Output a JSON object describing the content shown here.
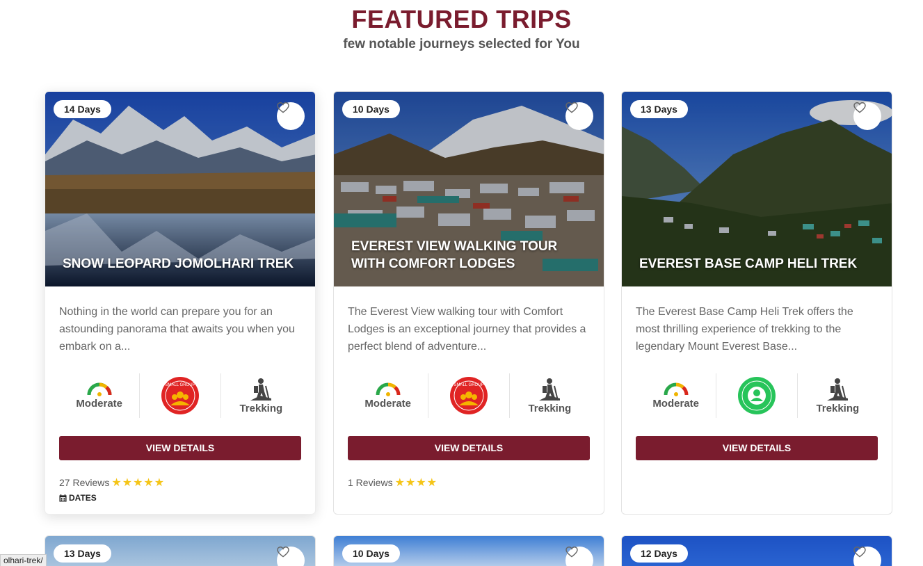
{
  "header": {
    "title": "FEATURED TRIPS",
    "subtitle": "few notable journeys selected for You"
  },
  "cards": [
    {
      "days": "14 Days",
      "title": "SNOW LEOPARD JOMOLHARI TREK",
      "description": "Nothing in the world can prepare you for an astounding panorama that awaits you when you embark on a...",
      "difficulty": "Moderate",
      "group_badge": "SMALL GROUP JOURNEYS",
      "group_badge_color": "#e02424",
      "activity": "Trekking",
      "button": "VIEW DETAILS",
      "reviews": "27 Reviews",
      "rating": 5,
      "dates": "DATES"
    },
    {
      "days": "10 Days",
      "title": "EVEREST VIEW WALKING TOUR WITH COMFORT LODGES",
      "description": "The Everest View walking tour with Comfort Lodges is an exceptional journey that provides a perfect blend of adventure...",
      "difficulty": "Moderate",
      "group_badge": "SMALL GROUP JOURNEYS",
      "group_badge_color": "#e02424",
      "activity": "Trekking",
      "button": "VIEW DETAILS",
      "reviews": "1 Reviews",
      "rating": 4
    },
    {
      "days": "13 Days",
      "title": "EVEREST BASE CAMP HELI TREK",
      "description": "The Everest Base Camp Heli Trek offers the most thrilling experience of trekking to the legendary Mount Everest Base...",
      "difficulty": "Moderate",
      "group_badge": "INDEPENDENT PRIVATE JOURNEYS",
      "group_badge_color": "#27c45a",
      "activity": "Trekking",
      "button": "VIEW DETAILS"
    }
  ],
  "next_row": [
    {
      "days": "13 Days"
    },
    {
      "days": "10 Days"
    },
    {
      "days": "12 Days"
    }
  ],
  "status_url": "olhari-trek/",
  "colors": {
    "brand": "#7a1c2e",
    "star": "#f5c518"
  }
}
